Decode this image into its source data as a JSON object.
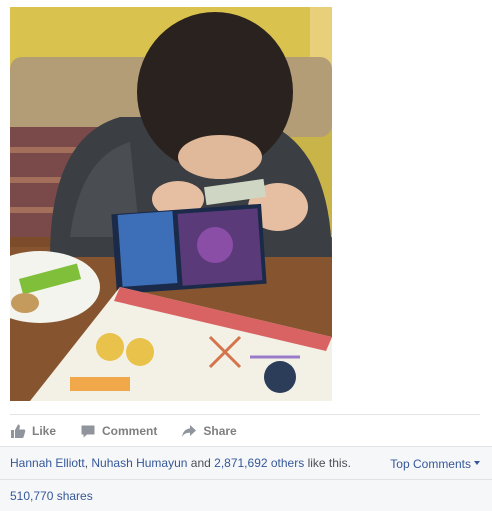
{
  "post": {
    "actions": [
      {
        "label": "Like",
        "icon": "thumbs-up-icon"
      },
      {
        "label": "Comment",
        "icon": "comment-icon"
      },
      {
        "label": "Share",
        "icon": "share-arrow-icon"
      }
    ],
    "likes": {
      "person1": "Hannah Elliott",
      "separator": ", ",
      "person2": "Nuhash Humayun",
      "and": " and ",
      "others_count": "2,871,692 others",
      "suffix": " like this."
    },
    "top_comments_label": "Top Comments",
    "shares_label": "510,770 shares"
  },
  "colors": {
    "link": "#365899",
    "action_gray": "#7f7f7f",
    "footer_bg": "#f6f7f9"
  }
}
